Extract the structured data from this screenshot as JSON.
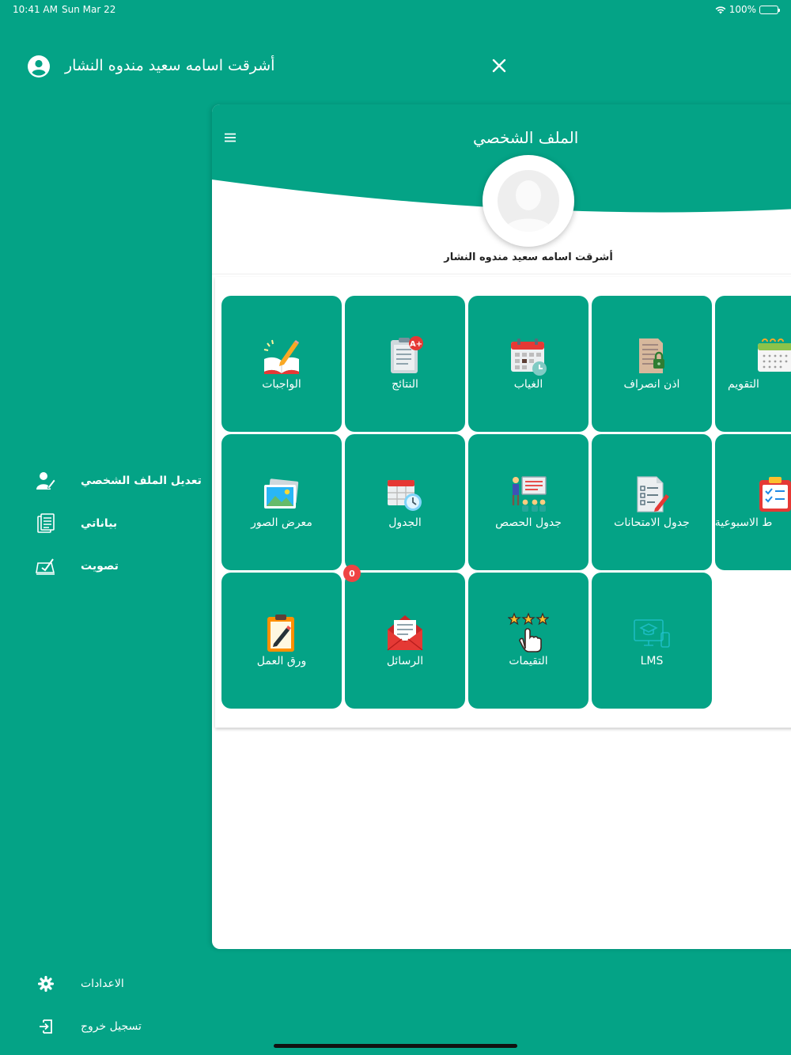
{
  "status_bar": {
    "time": "10:41 AM",
    "date": "Sun Mar 22",
    "battery": "100%"
  },
  "drawer": {
    "user_name": "أشرقت اسامه سعيد مندوه النشار",
    "menu": [
      {
        "label": "تعديل الملف الشخصي",
        "icon": "user-edit-icon"
      },
      {
        "label": "بياناتي",
        "icon": "data-sheet-icon"
      },
      {
        "label": "تصويت",
        "icon": "vote-icon"
      }
    ],
    "footer": [
      {
        "label": "الاعدادات",
        "icon": "gear-icon"
      },
      {
        "label": "تسجيل خروج",
        "icon": "logout-icon"
      }
    ]
  },
  "profile": {
    "title": "الملف الشخصي",
    "name": "أشرقت اسامه سعيد مندوه النشار"
  },
  "tiles": [
    {
      "label": "الواجبات",
      "icon": "homework-icon"
    },
    {
      "label": "النتائج",
      "icon": "results-icon"
    },
    {
      "label": "الغياب",
      "icon": "absence-calendar-icon"
    },
    {
      "label": "اذن انصراف",
      "icon": "leave-permission-icon"
    },
    {
      "label": "التقويم",
      "icon": "calendar-icon"
    },
    {
      "label": "معرض الصور",
      "icon": "photo-gallery-icon"
    },
    {
      "label": "الجدول",
      "icon": "schedule-icon"
    },
    {
      "label": "جدول الحصص",
      "icon": "class-schedule-icon"
    },
    {
      "label": "جدول الامتحانات",
      "icon": "exam-schedule-icon"
    },
    {
      "label": "ط الاسبوعية",
      "icon": "weekly-plan-icon"
    },
    {
      "label": "ورق العمل",
      "icon": "worksheet-icon"
    },
    {
      "label": "الرسائل",
      "icon": "messages-icon",
      "badge": "0"
    },
    {
      "label": "التقيمات",
      "icon": "ratings-icon"
    },
    {
      "label": "LMS",
      "icon": "lms-icon"
    }
  ],
  "colors": {
    "primary": "#04a386",
    "badge": "#ef4343",
    "card": "#ffffff"
  }
}
